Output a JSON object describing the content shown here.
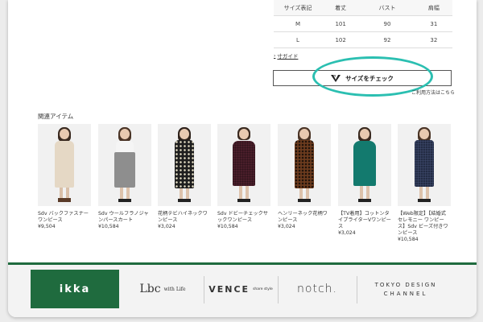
{
  "size_table": {
    "headers": [
      "サイズ表記",
      "着丈",
      "バスト",
      "肩幅"
    ],
    "rows": [
      [
        "M",
        "101",
        "90",
        "31"
      ],
      [
        "L",
        "102",
        "92",
        "32"
      ]
    ]
  },
  "size_guide_label": "寸ガイド",
  "check_button_label": "サイズをチェック",
  "usage_link_label": "ご利用方法はこちら",
  "related_title": "関連アイテム",
  "products": [
    {
      "name": "Sdv バックファスナーワンピース",
      "price": "¥9,504"
    },
    {
      "name": "Sdv ウールフラノジャンパースカート",
      "price": "¥10,584"
    },
    {
      "name": "花柄テビハイネックワンピース",
      "price": "¥3,024"
    },
    {
      "name": "Sdv ドビーチェックサックワンピース",
      "price": "¥10,584"
    },
    {
      "name": "ヘンリーネック花柄ワンピース",
      "price": "¥3,024"
    },
    {
      "name": "【TV着用】コットンタイプライターVワンピース",
      "price": "¥3,024"
    },
    {
      "name": "【Web限定】【結婚式 セレモニー ワンピース】Sdv ビーズ付きワンピース",
      "price": "¥10,584"
    }
  ],
  "brands": [
    "ikka",
    "Lbc",
    "with Life",
    "VENCE",
    "share style",
    "notch.",
    "TOKYO DESIGN",
    "CHANNEL"
  ],
  "colors": {
    "footer_green": "#1f6b3e",
    "highlight_ring": "#2bbfb1"
  }
}
